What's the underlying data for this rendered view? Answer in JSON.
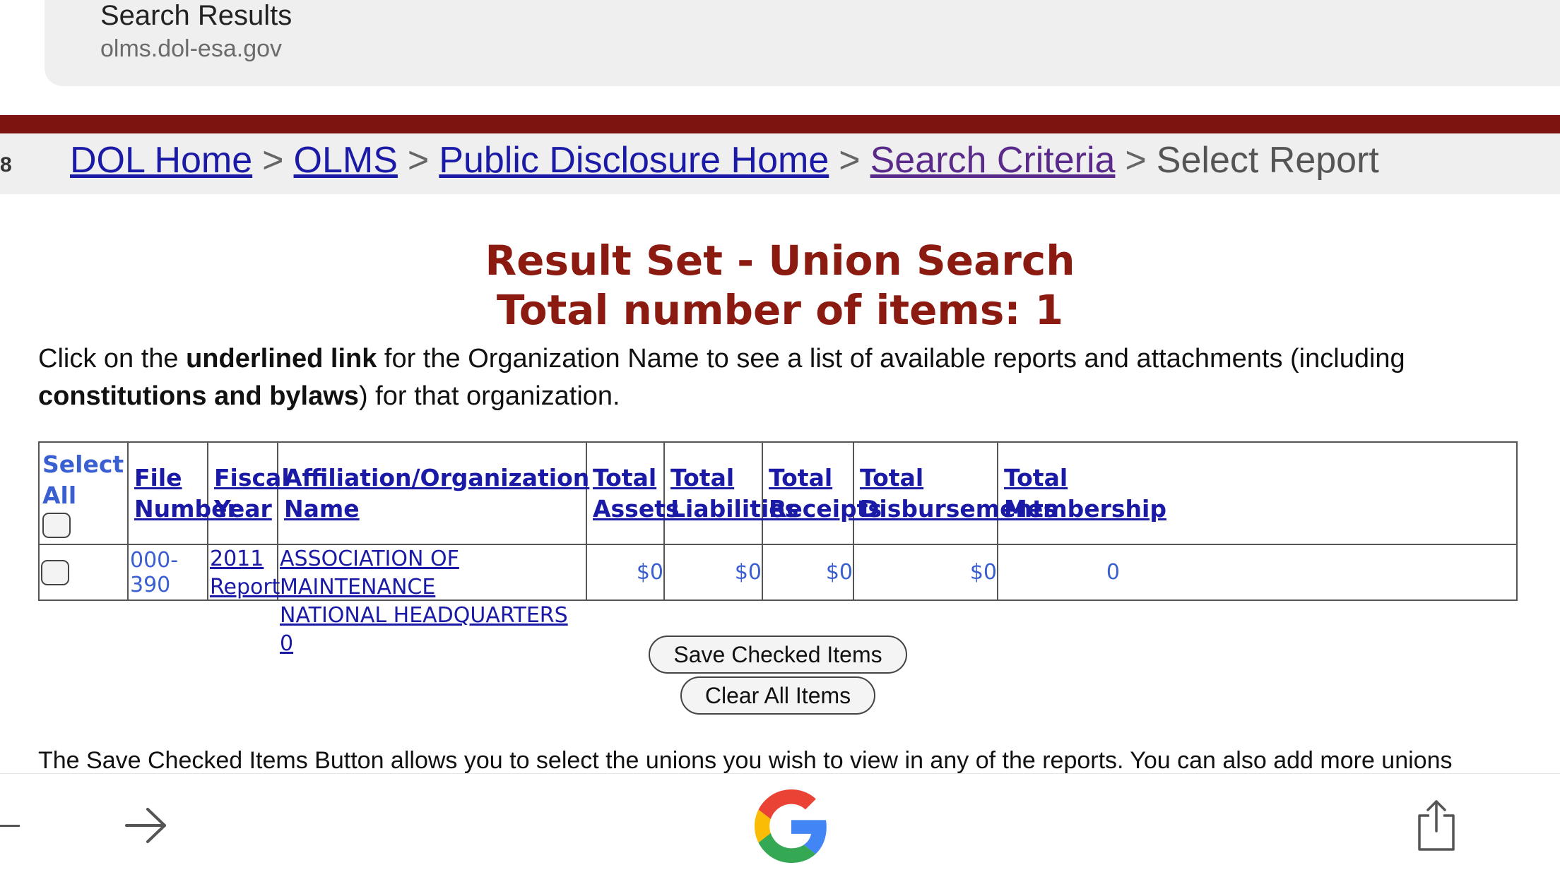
{
  "browser": {
    "title": "Search Results",
    "domain": "olms.dol-esa.gov"
  },
  "breadcrumb": {
    "stub": "8",
    "items": [
      {
        "label": "DOL Home"
      },
      {
        "label": "OLMS"
      },
      {
        "label": "Public Disclosure Home"
      },
      {
        "label": "Search Criteria"
      }
    ],
    "separator": ">",
    "current": "Select Report"
  },
  "headings": {
    "title": "Result Set - Union Search",
    "count": "Total number of items: 1"
  },
  "intro": {
    "part1": "Click on the ",
    "bold1": "underlined link",
    "part2": " for the Organization Name to see a list of available reports and attachments (including ",
    "bold2": "constitutions and bylaws",
    "part3": ") for that organization."
  },
  "table": {
    "headers": {
      "select_all_1": "Select",
      "select_all_2": "All",
      "file_1": "File",
      "file_2": "Number",
      "fiscal_1": "Fiscal",
      "fiscal_2": "Year",
      "org": "Affiliation/Organization Name",
      "assets_1": "Total",
      "assets_2": "Assets",
      "liab_1": "Total",
      "liab_2": "Liabilities",
      "receipts_1": "Total",
      "receipts_2": "Receipts",
      "disb_1": "Total",
      "disb_2": "Disbursements",
      "memb_1": "Total",
      "memb_2": "Membership"
    },
    "rows": [
      {
        "file_number": "000-390",
        "fiscal_1": "2011",
        "fiscal_2": "Report",
        "org_1": "ASSOCIATION OF MAINTENANCE",
        "org_2": "NATIONAL HEADQUARTERS 0",
        "assets": "$0",
        "liabilities": "$0",
        "receipts": "$0",
        "disbursements": "$0",
        "membership": "0"
      }
    ]
  },
  "buttons": {
    "save": "Save Checked Items",
    "clear": "Clear All Items"
  },
  "footer_text": "The Save Checked Items Button allows you to select the unions you wish to view in any of the reports. You can also add more unions",
  "icons": {
    "forward": "arrow-right-icon",
    "google": "google-g-icon",
    "share": "share-icon"
  },
  "colors": {
    "maroon": "#7d1410",
    "heading": "#8b1a10",
    "link": "#1a1aa6",
    "visited": "#5a2a8a"
  }
}
